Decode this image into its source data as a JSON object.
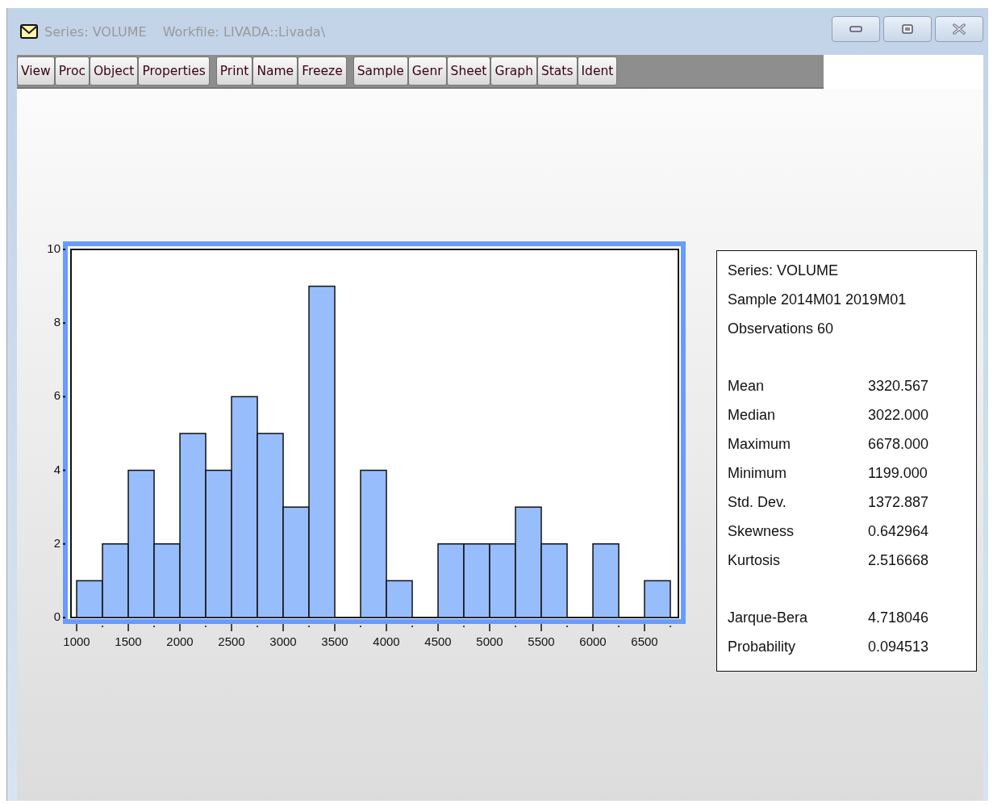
{
  "window": {
    "title": "Series: VOLUME",
    "subtitle": "Workfile: LIVADA::Livada\\"
  },
  "toolbar": [
    [
      "View",
      "Proc",
      "Object",
      "Properties"
    ],
    [
      "Print",
      "Name",
      "Freeze"
    ],
    [
      "Sample",
      "Genr",
      "Sheet",
      "Graph",
      "Stats",
      "Ident"
    ]
  ],
  "histogram": {
    "chart_data": {
      "type": "bar",
      "x": [
        1125,
        1375,
        1625,
        1875,
        2125,
        2375,
        2625,
        2875,
        3125,
        3375,
        3625,
        3875,
        4125,
        4375,
        4625,
        4875,
        5125,
        5375,
        5625,
        5875,
        6125,
        6375,
        6625
      ],
      "values": [
        1,
        2,
        4,
        2,
        5,
        4,
        6,
        5,
        3,
        9,
        0,
        4,
        1,
        0,
        2,
        2,
        2,
        3,
        2,
        0,
        2,
        0,
        1
      ],
      "xlim": [
        945,
        6828
      ],
      "ylim": [
        0,
        10
      ],
      "xticks": [
        1000,
        1500,
        2000,
        2500,
        3000,
        3500,
        4000,
        4500,
        5000,
        5500,
        6000,
        6500
      ],
      "yticks": [
        0,
        2,
        4,
        6,
        8,
        10
      ]
    }
  },
  "stats": {
    "header": [
      "Series: VOLUME",
      "Sample 2014M01 2019M01",
      "Observations 60"
    ],
    "statistics": [
      {
        "label": "Mean",
        "value": "3320.567"
      },
      {
        "label": "Median",
        "value": "3022.000"
      },
      {
        "label": "Maximum",
        "value": "6678.000"
      },
      {
        "label": "Minimum",
        "value": "1199.000"
      },
      {
        "label": "Std. Dev.",
        "value": "1372.887"
      },
      {
        "label": "Skewness",
        "value": "0.642964"
      },
      {
        "label": "Kurtosis",
        "value": "2.516668"
      }
    ],
    "tests": [
      {
        "label": "Jarque-Bera",
        "value": "4.718046"
      },
      {
        "label": "Probability",
        "value": "0.094513"
      }
    ]
  }
}
